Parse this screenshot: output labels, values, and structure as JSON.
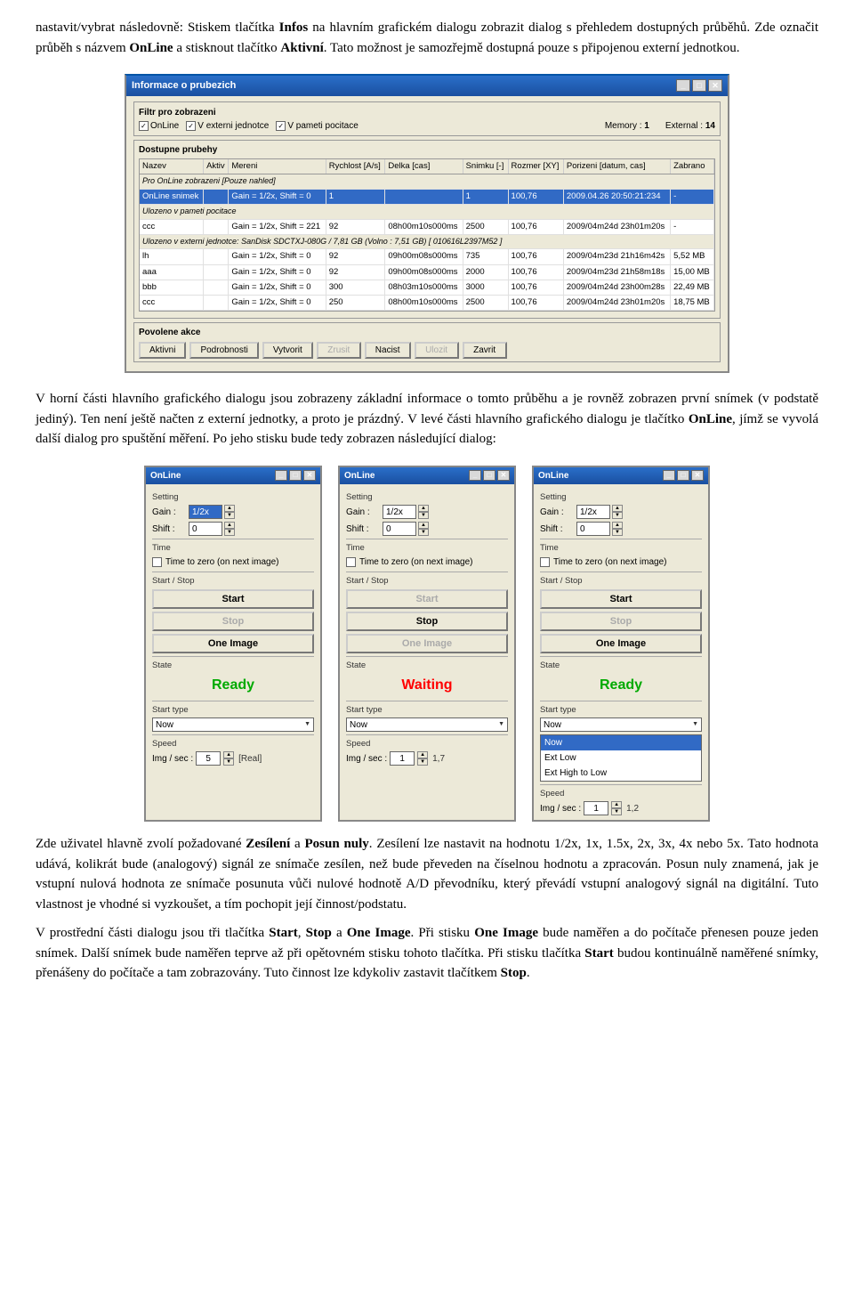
{
  "paragraphs": {
    "p1": "nastavit/vybrat následovně: Stiskem tlačítka Infos na hlavním grafickém dialogu zobrazit dialog s přehledem dostupných průběhů. Zde označit průběh s názvem OnLine a stisknout tlačítko Aktivní. Tato možnost je samozřejmě dostupná pouze s připojenou externí jednotkou.",
    "p2": "V horní části hlavního grafického dialogu jsou zobrazeny základní informace o tomto průběhu a je rovněž zobrazen první snímek (v podstatě jediný). Ten není ještě načten z externí jednotky, a proto je prázdný. V levé části hlavního grafického dialogu je tlačítko OnLine, jímž se vyvolá další dialog pro spuštění měření. Po jeho stisku bude tedy zobrazen následující dialog:",
    "p3": "Zde uživatel hlavně zvolí požadované Zesílení a Posun nuly. Zesílení lze nastavit na hodnotu 1/2x, 1x, 1.5x, 2x, 3x, 4x nebo 5x. Tato hodnota udává, kolikrát bude (analogový) signál ze snímače zesílen, než bude převeden na číselnou hodnotu a zpracován. Posun nuly znamená, jak je vstupní nulová hodnota ze snímače posunuta vůči nulové hodnotě A/D převodníku, který převádí vstupní analogový signál na digitální. Tuto vlastnost je vhodné si vyzkoušet, a tím pochopit její činnost/podstatu.",
    "p4": "V prostřední části dialogu jsou tři tlačítka Start, Stop a One Image. Při stisku One Image bude naměřen a do počítače přenesen pouze jeden snímek. Další snímek bude naměřen teprve až při opětovném stisku tohoto tlačítka. Při stisku tlačítka Start budou kontinuálně naměřené snímky, přenášeny do počítače a tam zobrazovány. Tuto činnost lze kdykoliv zastavit tlačítkem Stop."
  },
  "info_dialog": {
    "title": "Informace o prubezich",
    "filter_label": "Filtr pro zobrazeni",
    "filter_options": [
      "OnLine",
      "V externi jednotce",
      "V pameti pocitace"
    ],
    "memory_label": "Memory :",
    "memory_value": "1",
    "external_label": "External :",
    "external_value": "14",
    "available_label": "Dostupne prubehy",
    "columns": [
      "Nazev",
      "Aktiv",
      "Mereni",
      "Rychlost [A/s]",
      "Delka [cas]",
      "Snimku [-]",
      "Rozmer [XY]",
      "Porizeni [datum, cas]",
      "Zabrano"
    ],
    "online_row": "OnLine snimek",
    "online_detail": "Gain = 1/2x, Shift = 0",
    "section_pc": "Ulozeno v pameti pocitace",
    "pc_rows": [
      [
        "ccc",
        "",
        "Gain = 1/2x, Shift = 221",
        "92",
        "08h00m10s000ms",
        "2500",
        "100,76",
        "2009/04m24d 23h01m20s",
        ""
      ]
    ],
    "section_ext": "Ulozeno v externi jednotce: SanDisk SDCTXJ-080G / 7,81 GB (Volno : 7,51 GB) [ 010616L2397M52 ]",
    "ext_rows": [
      [
        "lh",
        "",
        "Gain = 1/2x, Shift = 0",
        "92",
        "09h00m08s000ms",
        "735",
        "100,76",
        "2009/04m23d 21h16m42s",
        "5,52 MB"
      ],
      [
        "aaa",
        "",
        "Gain = 1/2x, Shift = 0",
        "92",
        "09h00m08s000ms",
        "2000",
        "100,76",
        "2009/04m23d 21h58m18s",
        "15,00 MB"
      ],
      [
        "bbb",
        "",
        "Gain = 1/2x, Shift = 0",
        "300",
        "08h03m10s000ms",
        "3000",
        "100,76",
        "2009/04m24d 23h00m28s",
        "22,49 MB"
      ],
      [
        "ccc",
        "",
        "Gain = 1/2x, Shift = 0",
        "250",
        "08h00m10s000ms",
        "2500",
        "100,76",
        "2009/04m24d 23h01m20s",
        "18,75 MB"
      ]
    ],
    "action_label": "Povolene akce",
    "buttons": [
      "Aktivni",
      "Podrobnosti",
      "Vytvorit",
      "Zrusit",
      "Nacist",
      "Ulozit",
      "Zavrit"
    ]
  },
  "online_dialogs": [
    {
      "title": "OnLine",
      "setting_label": "Setting",
      "gain_label": "Gain :",
      "gain_value": "1/2x",
      "shift_label": "Shift :",
      "shift_value": "0",
      "time_label": "Time",
      "time_zero_label": "Time to zero (on next image)",
      "start_stop_label": "Start / Stop",
      "start_btn": "Start",
      "stop_btn": "Stop",
      "one_image_btn": "One Image",
      "state_label": "State",
      "state_value": "Ready",
      "state_class": "state-ready",
      "start_type_label": "Start type",
      "start_type_value": "Now",
      "speed_label": "Speed",
      "img_sec_label": "Img / sec :",
      "img_sec_value": "5",
      "real_label": "[Real]",
      "start_enabled": true,
      "stop_enabled": false,
      "one_image_enabled": true
    },
    {
      "title": "OnLine",
      "setting_label": "Setting",
      "gain_label": "Gain :",
      "gain_value": "1/2x",
      "shift_label": "Shift :",
      "shift_value": "0",
      "time_label": "Time",
      "time_zero_label": "Time to zero (on next image)",
      "start_stop_label": "Start / Stop",
      "start_btn": "Start",
      "stop_btn": "Stop",
      "one_image_btn": "One Image",
      "state_label": "State",
      "state_value": "Waiting",
      "state_class": "state-waiting",
      "start_type_label": "Start type",
      "start_type_value": "Now",
      "speed_label": "Speed",
      "img_sec_label": "Img / sec :",
      "img_sec_value": "1",
      "real_label": "1,7",
      "start_enabled": false,
      "stop_enabled": true,
      "one_image_enabled": false
    },
    {
      "title": "OnLine",
      "setting_label": "Setting",
      "gain_label": "Gain :",
      "gain_value": "1/2x",
      "shift_label": "Shift :",
      "shift_value": "0",
      "time_label": "Time",
      "time_zero_label": "Time to zero (on next image)",
      "start_stop_label": "Start / Stop",
      "start_btn": "Start",
      "stop_btn": "Stop",
      "one_image_btn": "One Image",
      "state_label": "State",
      "state_value": "Ready",
      "state_class": "state-ready",
      "start_type_label": "Start type",
      "start_type_value": "Now",
      "speed_label": "Speed",
      "img_sec_label": "Img / sec :",
      "img_sec_value": "1",
      "real_label": "1,2",
      "start_enabled": true,
      "stop_enabled": false,
      "one_image_enabled": true,
      "show_dropdown_list": true,
      "dropdown_items": [
        "Now",
        "Ext Low",
        "Ext High to Low"
      ]
    }
  ],
  "bold_words": {
    "infos": "Infos",
    "online": "OnLine",
    "aktivni": "Aktivní",
    "online2": "OnLine",
    "zesileniBold": "Zesílení",
    "posunBold": "Posun nuly",
    "zesilenictx": "Zesílení",
    "start": "Start",
    "stop": "Stop",
    "one_image": "One Image",
    "one_image2": "One Image",
    "start2": "Start",
    "stop2": "Stop"
  }
}
